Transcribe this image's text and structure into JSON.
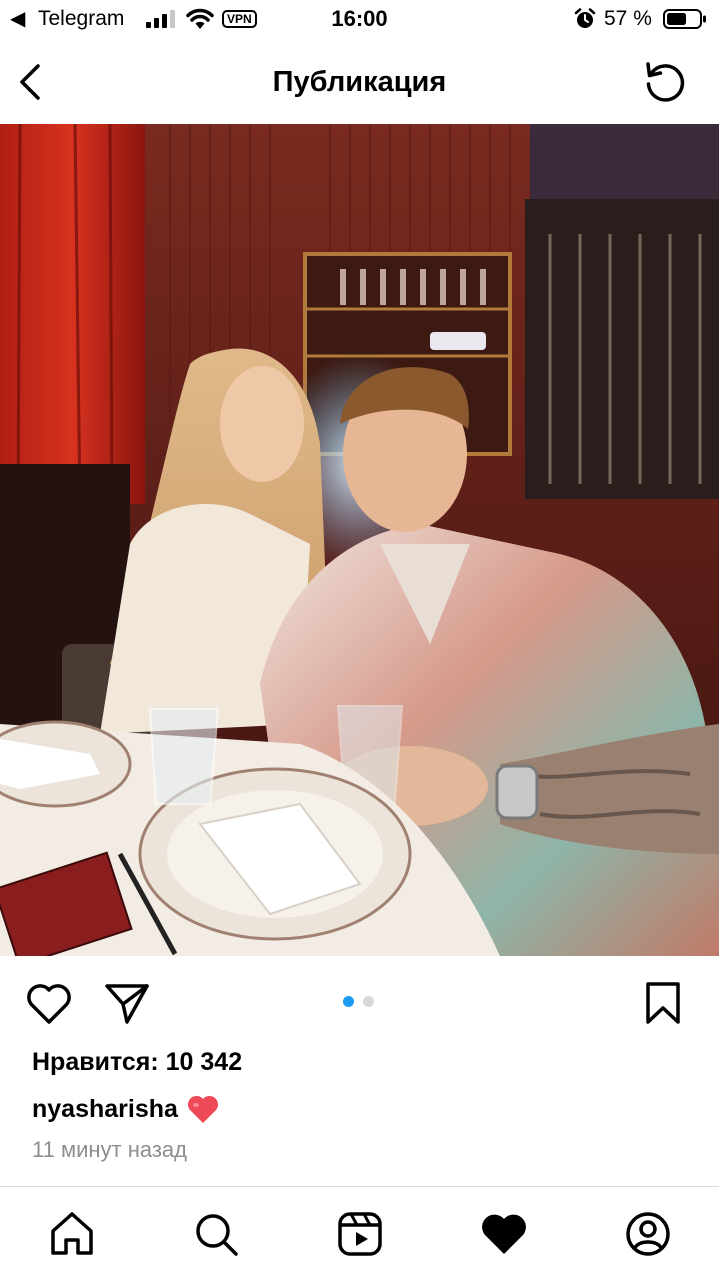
{
  "status_bar": {
    "back_glyph": "◀",
    "app": "Telegram",
    "vpn": "VPN",
    "time": "16:00",
    "battery": "57 %",
    "icons": [
      "signal-icon",
      "wifi-icon",
      "alarm-icon",
      "battery-icon"
    ]
  },
  "header": {
    "title": "Публикация",
    "icons": [
      "chevron-left-icon",
      "refresh-icon"
    ]
  },
  "post": {
    "likes": "Нравится: 10 342",
    "username": "nyasharisha",
    "time_ago": "11 минут назад",
    "carousel": {
      "pages": 2,
      "current": 1
    },
    "colors": {
      "dot_active": "#1d9bf0",
      "dot_inactive": "#d7d7d7",
      "heart": "#ed4956"
    }
  },
  "actions": {
    "icons": [
      "heart-outline-icon",
      "send-icon",
      "bookmark-icon"
    ]
  },
  "bottom_nav": {
    "items": [
      "home-icon",
      "search-icon",
      "reels-icon",
      "activity-heart-icon",
      "profile-icon"
    ],
    "active": "activity-heart-icon"
  }
}
